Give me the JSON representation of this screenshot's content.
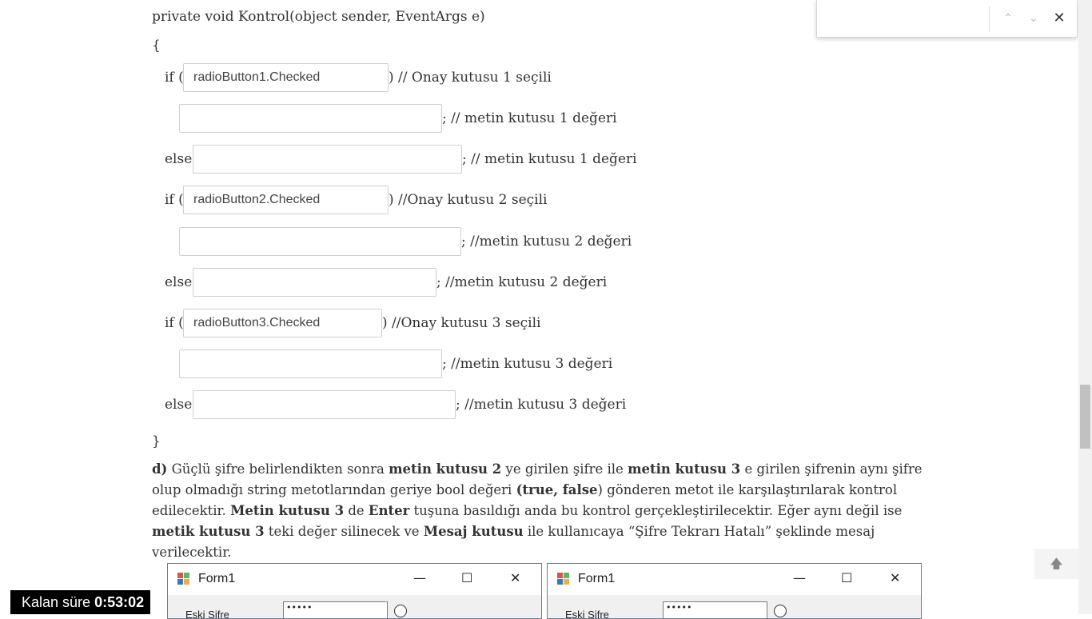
{
  "code": {
    "signature": "private void Kontrol(object sender, EventArgs e)",
    "open_brace": "{",
    "close_brace": "}",
    "if_kw": "if (",
    "else_kw": "else",
    "lines": [
      {
        "field": "radioButton1.Checked",
        "suffix": ") // Onay kutusu 1 seçili"
      },
      {
        "field": "",
        "suffix": "; // metin kutusu 1 değeri"
      },
      {
        "field": "",
        "suffix": "; // metin kutusu 1 değeri"
      },
      {
        "field": "radioButton2.Checked",
        "suffix": ") //Onay kutusu 2 seçili"
      },
      {
        "field": "",
        "suffix": "; //metin kutusu 2 değeri"
      },
      {
        "field": "",
        "suffix": "; //metin kutusu 2 değeri"
      },
      {
        "field": "radioButton3.Checked",
        "suffix": ") //Onay kutusu 3 seçili"
      },
      {
        "field": "",
        "suffix": "; //metin kutusu 3 değeri"
      },
      {
        "field": "",
        "suffix": "; //metin kutusu 3 değeri"
      }
    ]
  },
  "paragraph": {
    "d_label": "d)",
    "t1": " Güçlü şifre belirlendikten sonra ",
    "b1": "metin kutusu 2",
    "t2": " ye girilen şifre ile ",
    "b2": "metin kutusu 3",
    "t3": " e girilen şifrenin aynı şifre olup olmadığı string metotlarından geriye bool değeri ",
    "b3": "(true, false",
    "t4": ") gönderen metot ile karşılaştırılarak kontrol edilecektir. ",
    "b4": "Metin kutusu 3",
    "t5": " de ",
    "b5": "Enter",
    "t6": " tuşuna basıldığı anda bu kontrol gerçekleştirilecektir. Eğer aynı değil ise ",
    "b6": "metik kutusu 3",
    "t7": " teki değer silinecek ve ",
    "b7": "Mesaj kutusu",
    "t8": " ile kullanıcaya “Şifre Tekrarı Hatalı”  şeklinde mesaj verilecektir."
  },
  "findbar": {
    "query": "",
    "prev_icon": "chevron-up-icon",
    "next_icon": "chevron-down-icon",
    "close_icon": "close-icon"
  },
  "timer": {
    "label": "Kalan süre",
    "value": "0:53:02"
  },
  "back_to_top_icon": "arrow-up-icon",
  "forms": [
    {
      "title": "Form1",
      "field_label": "Eski Şifre",
      "password_mask": "•••••"
    },
    {
      "title": "Form1",
      "field_label": "Eski Şifre",
      "password_mask": "•••••"
    }
  ],
  "colors": {
    "text": "#333333",
    "timer_bg": "#000000",
    "form_border": "#6b7f95"
  }
}
